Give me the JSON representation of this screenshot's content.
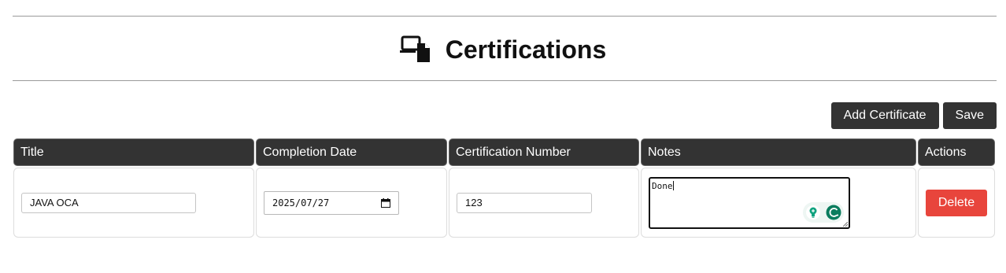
{
  "page": {
    "title": "Certifications",
    "icons": {
      "header": "devices-icon"
    }
  },
  "toolbar": {
    "add_label": "Add Certificate",
    "save_label": "Save"
  },
  "table": {
    "headers": [
      "Title",
      "Completion Date",
      "Certification Number",
      "Notes",
      "Actions"
    ],
    "rows": [
      {
        "title": "JAVA OCA",
        "completion_date": "2025/07/27",
        "certification_number": "123",
        "notes": "Done",
        "action_label": "Delete"
      }
    ]
  },
  "colors": {
    "header_bg": "#333333",
    "delete_bg": "#e8453c",
    "assistant_green": "#10a37f"
  }
}
